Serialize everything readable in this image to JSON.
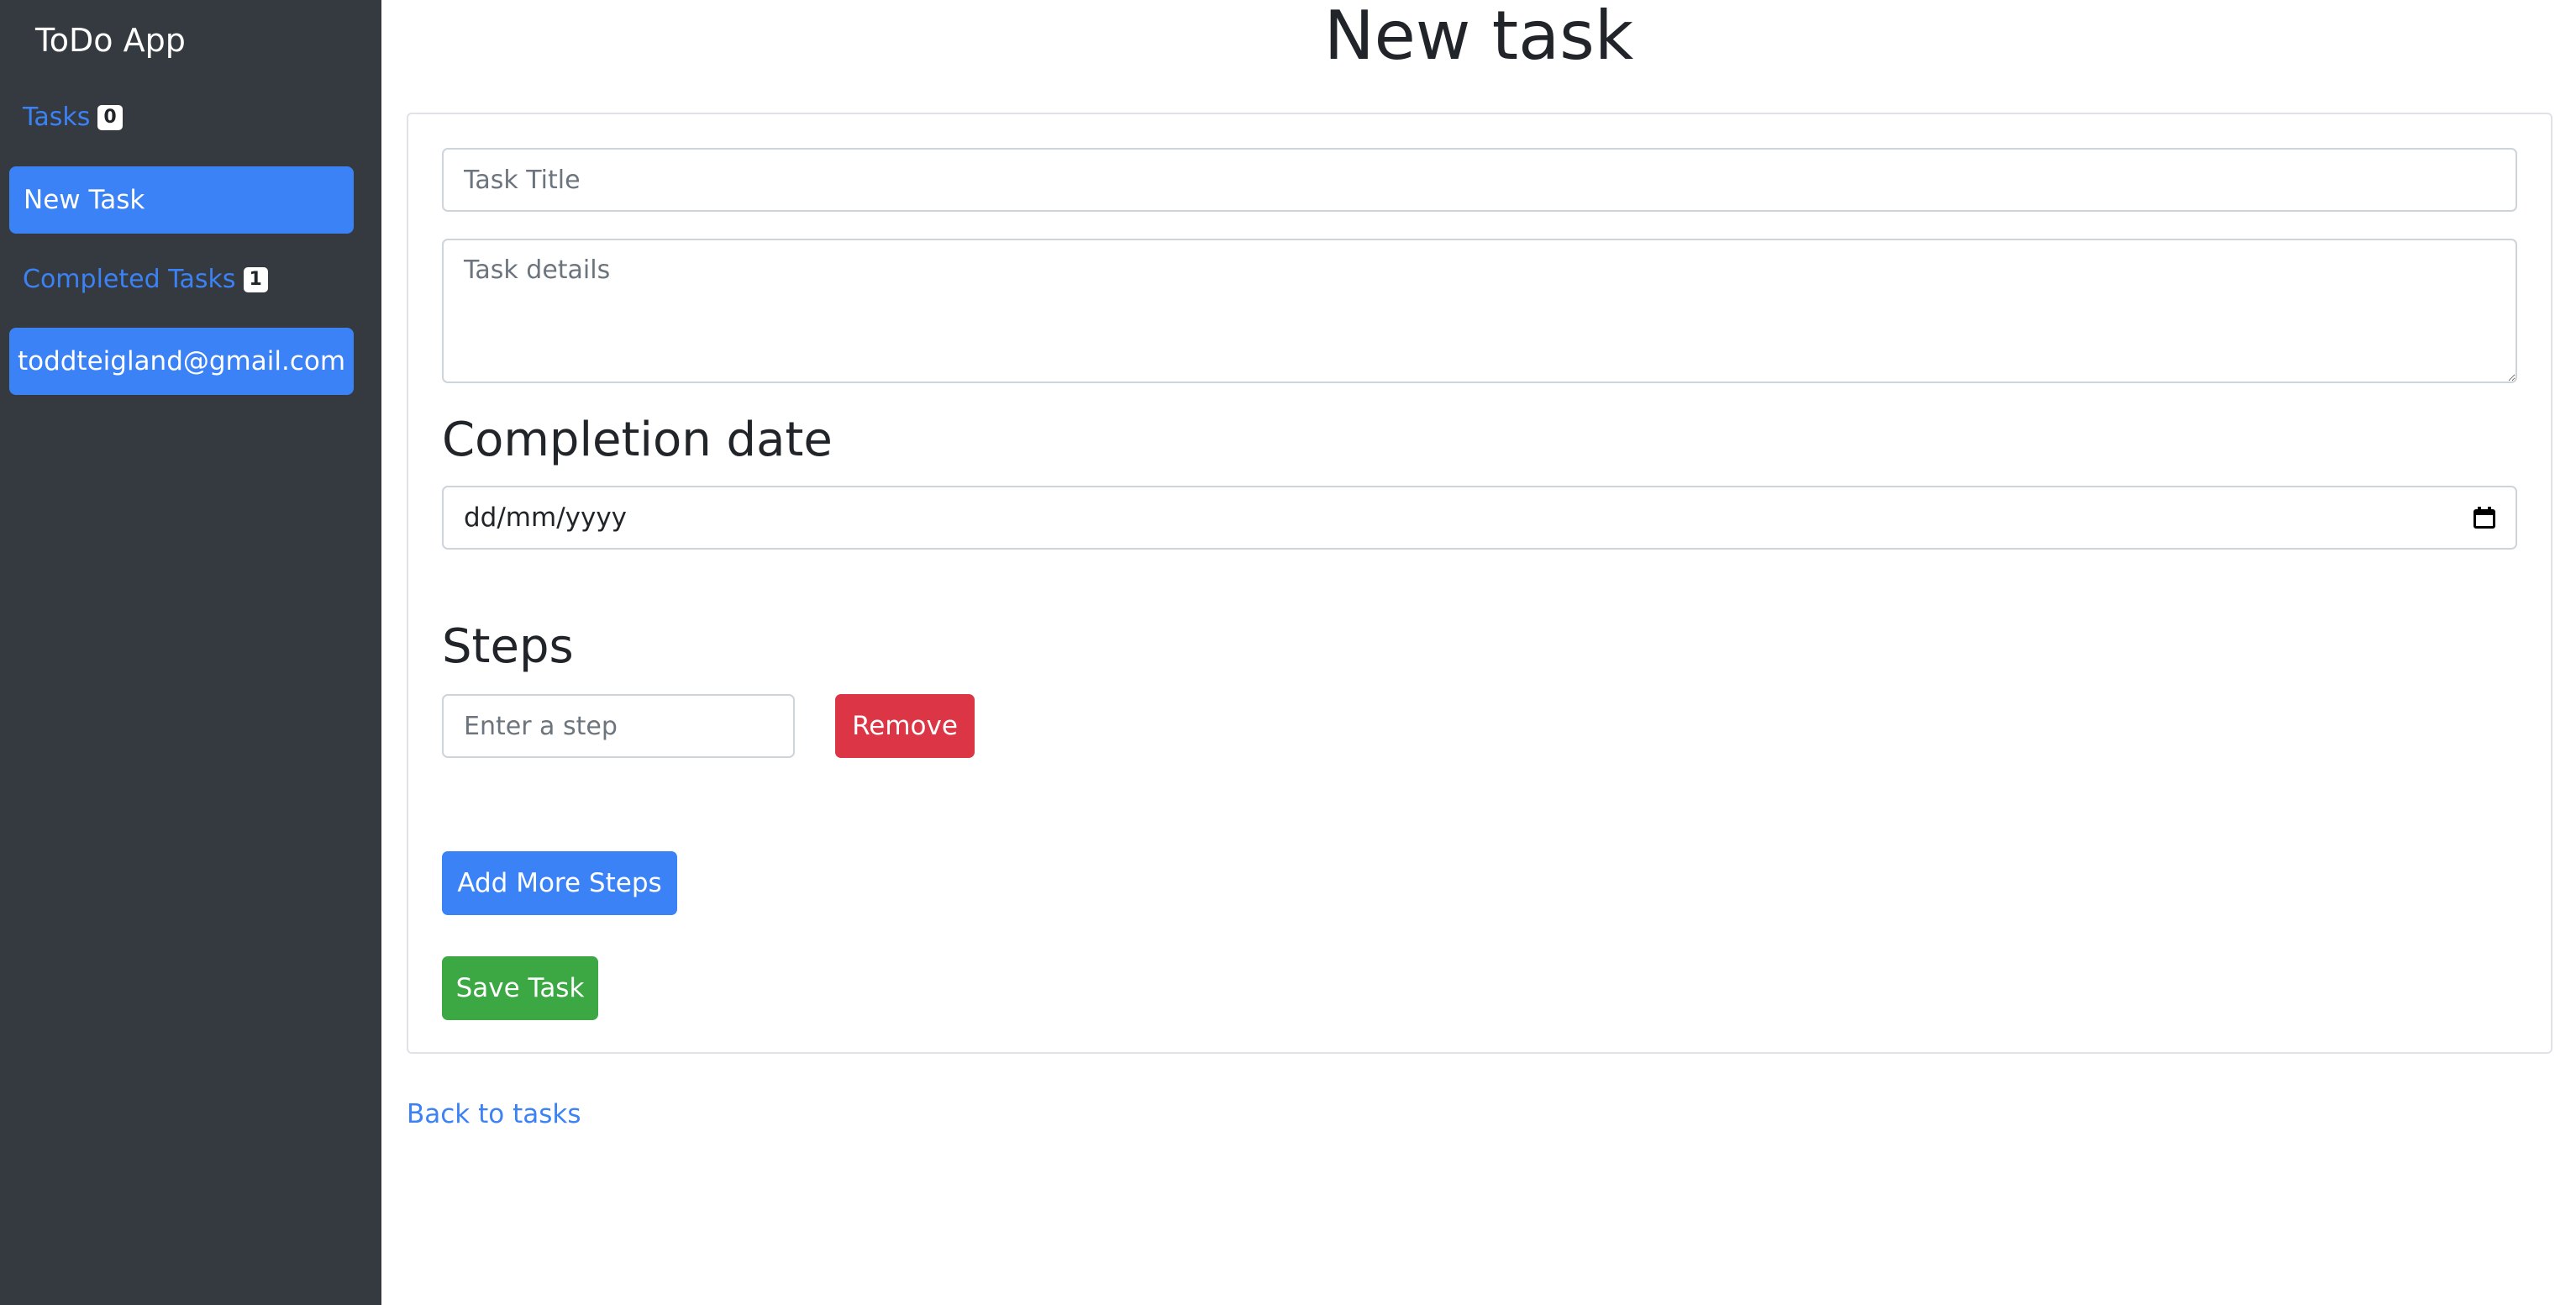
{
  "sidebar": {
    "brand": "ToDo App",
    "tasks": {
      "label": "Tasks",
      "count": "0"
    },
    "new_task": "New Task",
    "completed": {
      "label": "Completed Tasks",
      "count": "1"
    },
    "user_email": "toddteigland@gmail.com"
  },
  "page": {
    "title": "New task"
  },
  "form": {
    "title_placeholder": "Task Title",
    "details_placeholder": "Task details",
    "completion_heading": "Completion date",
    "date_placeholder": "dd/mm/yyyy",
    "steps_heading": "Steps",
    "step_placeholder": "Enter a step",
    "remove_label": "Remove",
    "add_steps_label": "Add More Steps",
    "save_label": "Save Task"
  },
  "back_link": "Back to tasks",
  "colors": {
    "sidebar_bg": "#343a40",
    "primary": "#3b82f6",
    "danger": "#dc3545",
    "success": "#3ca843"
  },
  "icons": {
    "date_picker": "calendar-icon"
  }
}
